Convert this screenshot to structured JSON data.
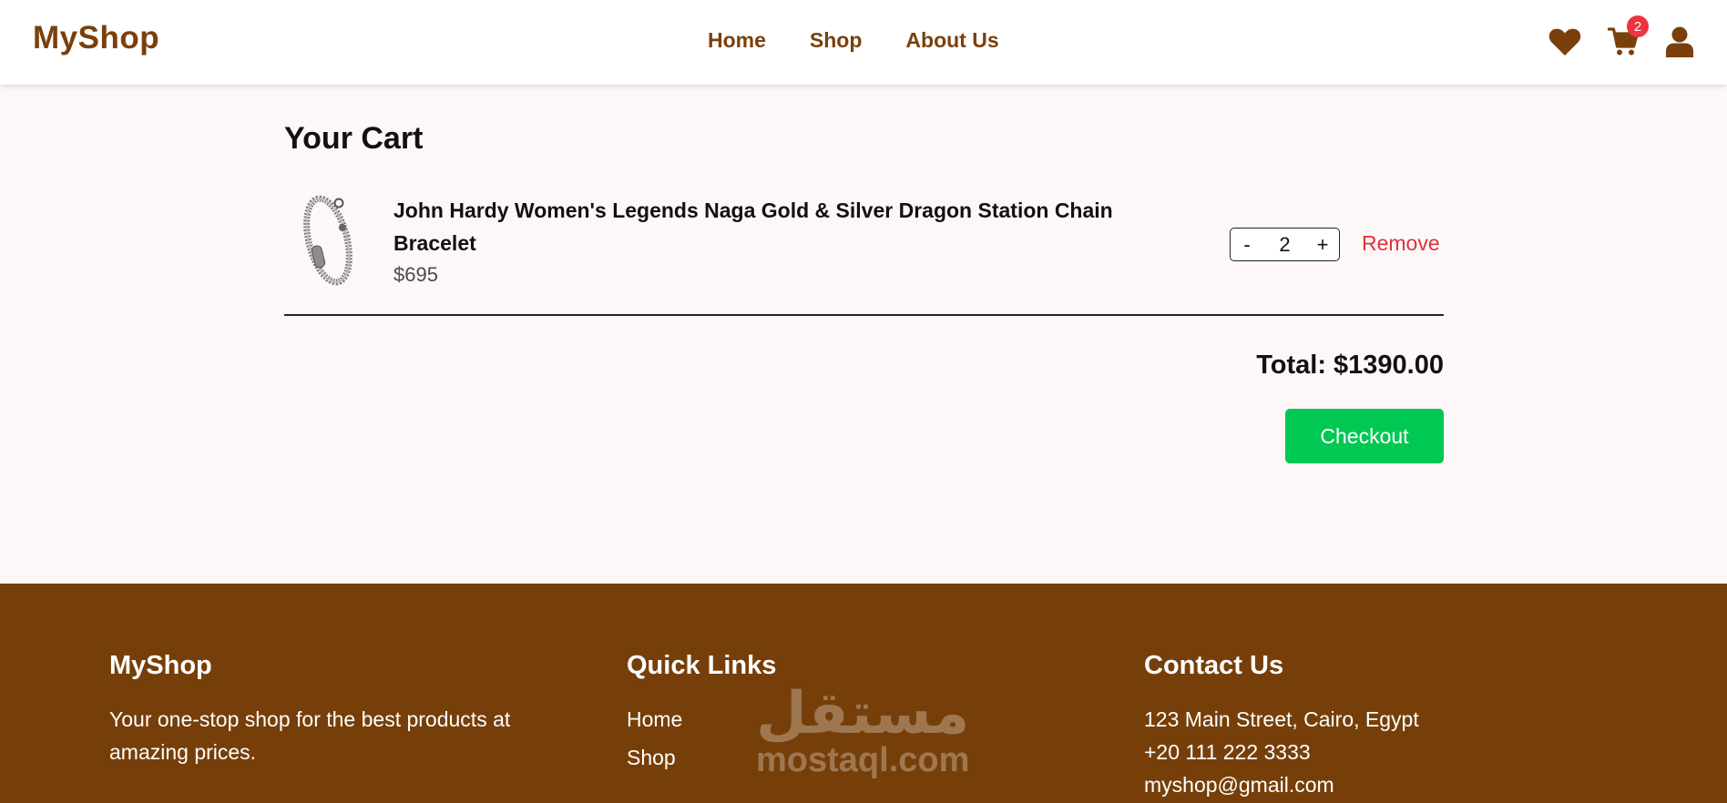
{
  "header": {
    "logo": "MyShop",
    "nav": [
      "Home",
      "Shop",
      "About Us"
    ],
    "cart_count": "2"
  },
  "cart": {
    "title": "Your Cart",
    "items": [
      {
        "name": "John Hardy Women's Legends Naga Gold & Silver Dragon Station Chain Bracelet",
        "price": "$695",
        "qty": "2",
        "remove_label": "Remove",
        "minus": "-",
        "plus": "+"
      }
    ],
    "total": "Total: $1390.00",
    "checkout_label": "Checkout"
  },
  "footer": {
    "brand": {
      "title": "MyShop",
      "text": "Your one-stop shop for the best products at amazing prices."
    },
    "links": {
      "title": "Quick Links",
      "items": [
        "Home",
        "Shop"
      ]
    },
    "contact": {
      "title": "Contact Us",
      "address": "123 Main Street, Cairo, Egypt",
      "phone": "+20 111 222 3333",
      "email": "myshop@gmail.com"
    }
  },
  "watermark": {
    "arabic": "مستقل",
    "latin": "mostaql.com"
  },
  "colors": {
    "brand": "#7a400c",
    "footer_bg": "#763f0a",
    "checkout": "#00c853",
    "remove": "#e0303b",
    "badge": "#ef3340"
  },
  "icons": [
    "heart-icon",
    "cart-icon",
    "user-icon"
  ]
}
